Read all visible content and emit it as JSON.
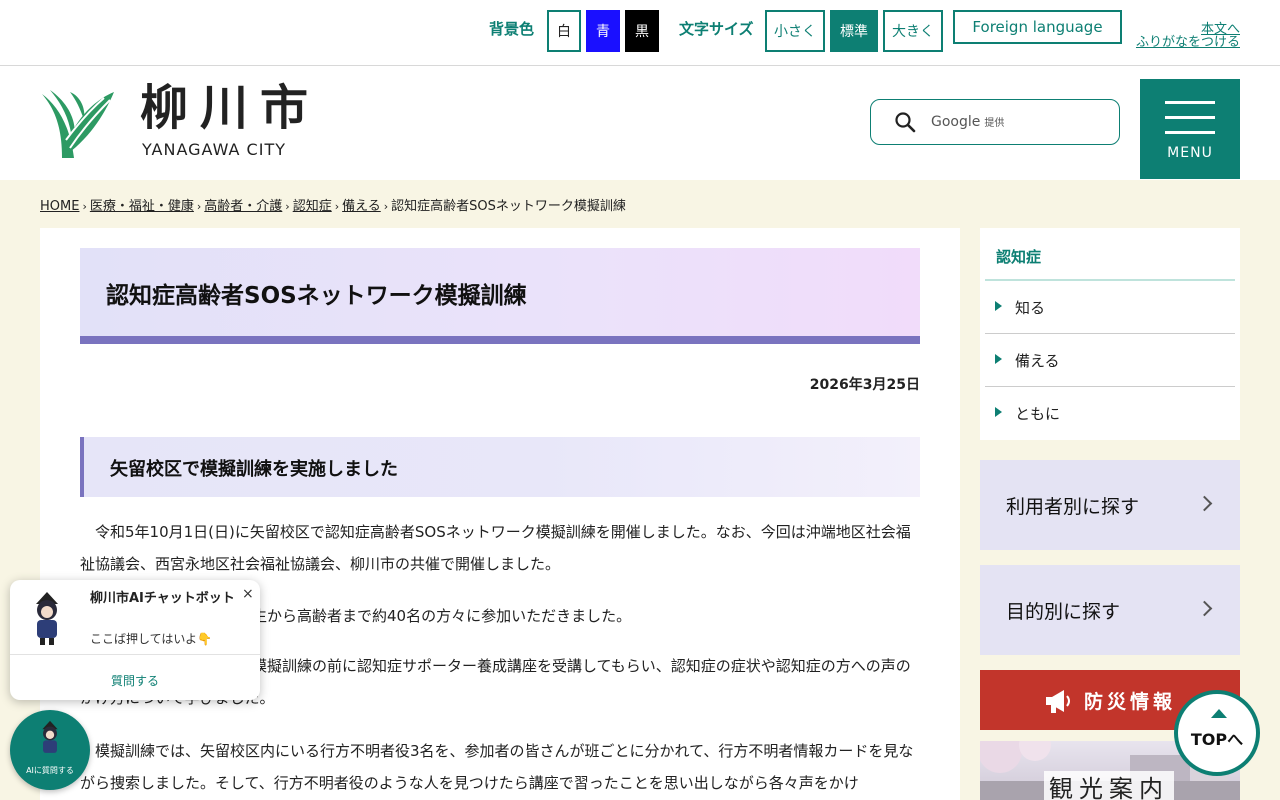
{
  "utility": {
    "bg_label": "背景色",
    "bg_white": "白",
    "bg_blue": "青",
    "bg_black": "黒",
    "text_size_label": "文字サイズ",
    "size_small": "小さく",
    "size_normal": "標準",
    "size_large": "大きく",
    "foreign": "Foreign language",
    "honbun": "本文へ",
    "furigana": "ふりがなをつける"
  },
  "header": {
    "logo_jp": "柳川市",
    "logo_en": "YANAGAWA CITY",
    "search_provider": "Google",
    "search_provider_sub": "提供",
    "menu_label": "MENU"
  },
  "breadcrumb": [
    "HOME",
    "医療・福祉・健康",
    "高齢者・介護",
    "認知症",
    "備える",
    "認知症高齢者SOSネットワーク模擬訓練"
  ],
  "article": {
    "title": "認知症高齢者SOSネットワーク模擬訓練",
    "date": "2026年3月25日",
    "section_heading": "矢留校区で模擬訓練を実施しました",
    "p1": "令和5年10月1日(日)に矢留校区で認知症高齢者SOSネットワーク模擬訓練を開催しました。なお、今回は沖端地区社会福祉協議会、西宮永地区社会福祉協議会、柳川市の共催で開催しました。",
    "p2": "生から高齢者まで約40名の方々に参加いただきました。",
    "p3": "模擬訓練の前に認知症サポーター養成講座を受講してもらい、認知症の症状や認知症の方への声のかけ方について学びました。",
    "p4": "模擬訓練では、矢留校区内にいる行方不明者役3名を、参加者の皆さんが班ごとに分かれて、行方不明者情報カードを見ながら捜索しました。そして、行方不明者役のような人を見つけたら講座で習ったことを思い出しながら各々声をかけ"
  },
  "sidebar": {
    "heading": "認知症",
    "items": [
      {
        "label": "知る"
      },
      {
        "label": "備える"
      },
      {
        "label": "ともに"
      }
    ],
    "search_by_user": "利用者別に探す",
    "search_by_purpose": "目的別に探す",
    "bousai": "防災情報",
    "kanko": "観光案内"
  },
  "top_button": "TOPへ",
  "chatbot": {
    "title": "柳川市AIチャットボット",
    "subtitle": "ここば押してはいよ👇",
    "close": "×",
    "ask": "質問する",
    "fab_label": "AIに質問する"
  },
  "colors": {
    "brand": "#0d7f73",
    "accent_purple": "#7a73bf",
    "disaster_red": "#c2352b",
    "page_bg": "#f8f5e4"
  },
  "icons": [
    "search-icon",
    "hamburger-icon",
    "megaphone-icon",
    "chevron-right-icon",
    "arrow-up-icon",
    "triangle-bullet-icon",
    "close-icon"
  ]
}
